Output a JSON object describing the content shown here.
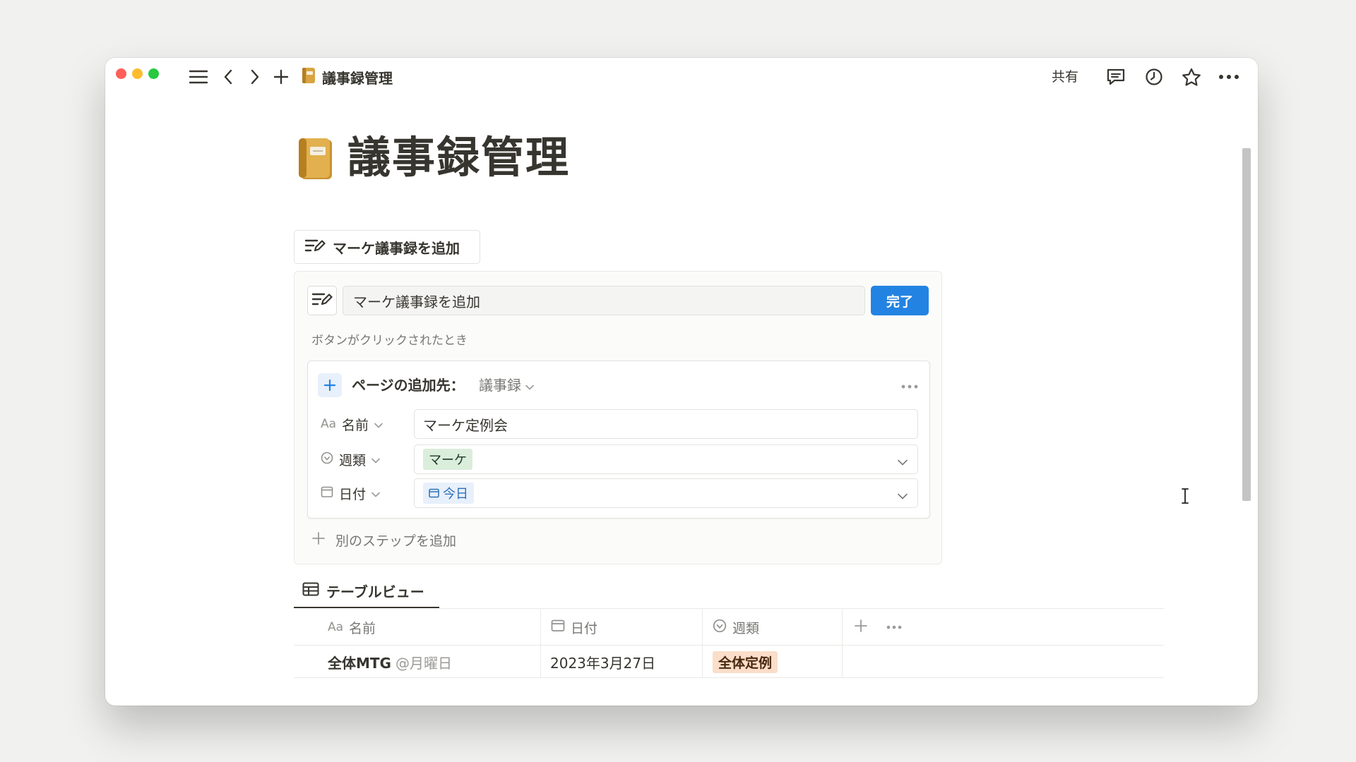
{
  "titlebar": {
    "breadcrumb_title": "議事録管理",
    "share_label": "共有",
    "icons": [
      "menu-icon",
      "back-icon",
      "forward-icon",
      "new-page-icon",
      "comment-icon",
      "history-icon",
      "star-icon",
      "more-icon"
    ]
  },
  "page": {
    "title": "議事録管理",
    "icon": "notebook-icon"
  },
  "button_block": {
    "label": "マーケ議事録を追加"
  },
  "editor": {
    "name_value": "マーケ議事録を追加",
    "done_label": "完了",
    "when_clicked_label": "ボタンがクリックされたとき",
    "step": {
      "title": "ページの追加先：",
      "target_db": "議事録",
      "properties": [
        {
          "label": "名前",
          "prefix": "Aa",
          "value": "マーケ定例会"
        },
        {
          "label": "週類",
          "value": "マーケ",
          "tag_color": "#dbeddb"
        },
        {
          "label": "日付",
          "value": "今日",
          "tag_color": "#e7f0fb"
        }
      ]
    },
    "add_step_label": "別のステップを追加"
  },
  "table_view": {
    "tab_label": "テーブルビュー",
    "columns": [
      {
        "label": "名前",
        "prefix": "Aa"
      },
      {
        "label": "日付"
      },
      {
        "label": "週類"
      }
    ],
    "rows": [
      {
        "name": "全体MTG",
        "mention": "@月曜日",
        "date": "2023年3月27日",
        "type": "全体定例",
        "type_color": "#fadec9"
      }
    ]
  },
  "colors": {
    "accent": "#2383e2",
    "text": "#37352f",
    "muted": "#787774",
    "background": "#f1f1ef"
  }
}
